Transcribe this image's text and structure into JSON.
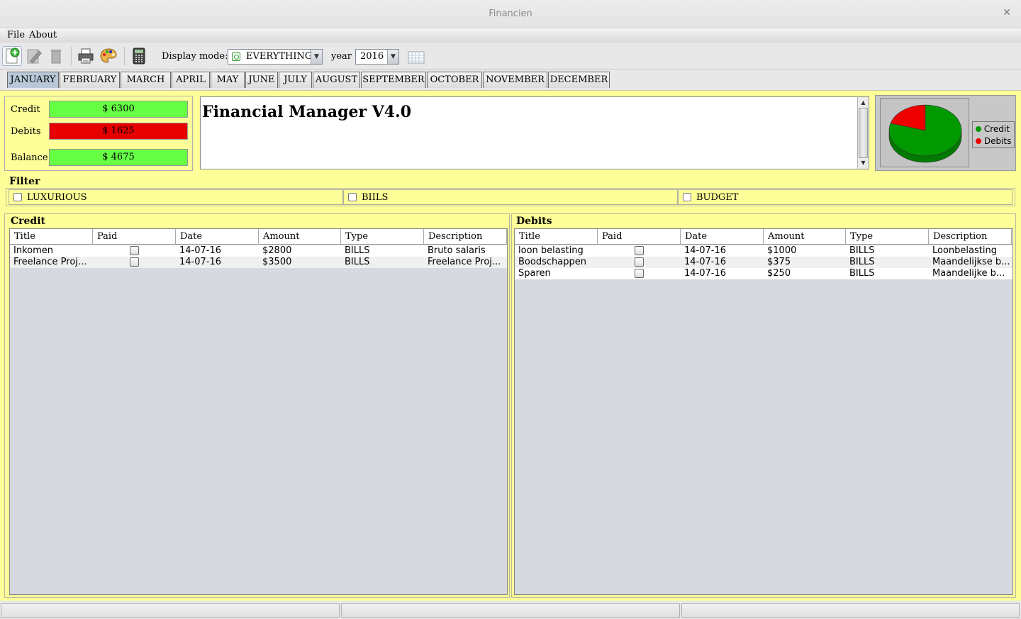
{
  "window": {
    "title": "Financien"
  },
  "menu": {
    "file": "File",
    "about": "About"
  },
  "toolbar": {
    "display_mode_label": "Display mode:",
    "display_mode_value": "EVERYTHING",
    "year_label": "year",
    "year_value": "2016"
  },
  "months": [
    "JANUARY",
    "FEBRUARY",
    "MARCH",
    "APRIL",
    "MAY",
    "JUNE",
    "JULY",
    "AUGUST",
    "SEPTEMBER",
    "OCTOBER",
    "NOVEMBER",
    "DECEMBER"
  ],
  "selected_month": "JANUARY",
  "summary": {
    "credit_label": "Credit",
    "credit_value": "$ 6300",
    "debits_label": "Debits",
    "debits_value": "$ 1625",
    "balance_label": "Balance",
    "balance_value": "$ 4675"
  },
  "notes": {
    "heading": "Financial Manager V4.0"
  },
  "chart_data": {
    "type": "pie",
    "categories": [
      "Credit",
      "Debits"
    ],
    "values": [
      6300,
      1625
    ],
    "colors": [
      "#009900",
      "#ee0000"
    ],
    "legend_position": "right"
  },
  "filter": {
    "title": "Filter",
    "options": [
      "LUXURIOUS",
      "BIILS",
      "BUDGET"
    ]
  },
  "credit_table": {
    "title": "Credit",
    "columns": [
      "Title",
      "Paid",
      "Date",
      "Amount",
      "Type",
      "Description"
    ],
    "rows": [
      {
        "title": "Inkomen",
        "paid": false,
        "date": "14-07-16",
        "amount": "$2800",
        "type": "BILLS",
        "description": "Bruto salaris"
      },
      {
        "title": "Freelance Proj...",
        "paid": false,
        "date": "14-07-16",
        "amount": "$3500",
        "type": "BILLS",
        "description": "Freelance Proj..."
      }
    ]
  },
  "debits_table": {
    "title": "Debits",
    "columns": [
      "Title",
      "Paid",
      "Date",
      "Amount",
      "Type",
      "Description"
    ],
    "rows": [
      {
        "title": "loon belasting",
        "paid": false,
        "date": "14-07-16",
        "amount": "$1000",
        "type": "BILLS",
        "description": "Loonbelasting"
      },
      {
        "title": "Boodschappen",
        "paid": false,
        "date": "14-07-16",
        "amount": "$375",
        "type": "BILLS",
        "description": "Maandelijkse b..."
      },
      {
        "title": "Sparen",
        "paid": false,
        "date": "14-07-16",
        "amount": "$250",
        "type": "BILLS",
        "description": "Maandelijke b..."
      }
    ]
  },
  "colors": {
    "panel_bg": "#ffff99",
    "positive": "#66ff44",
    "negative": "#e60000",
    "selected_tab": "#b9c8d8"
  }
}
